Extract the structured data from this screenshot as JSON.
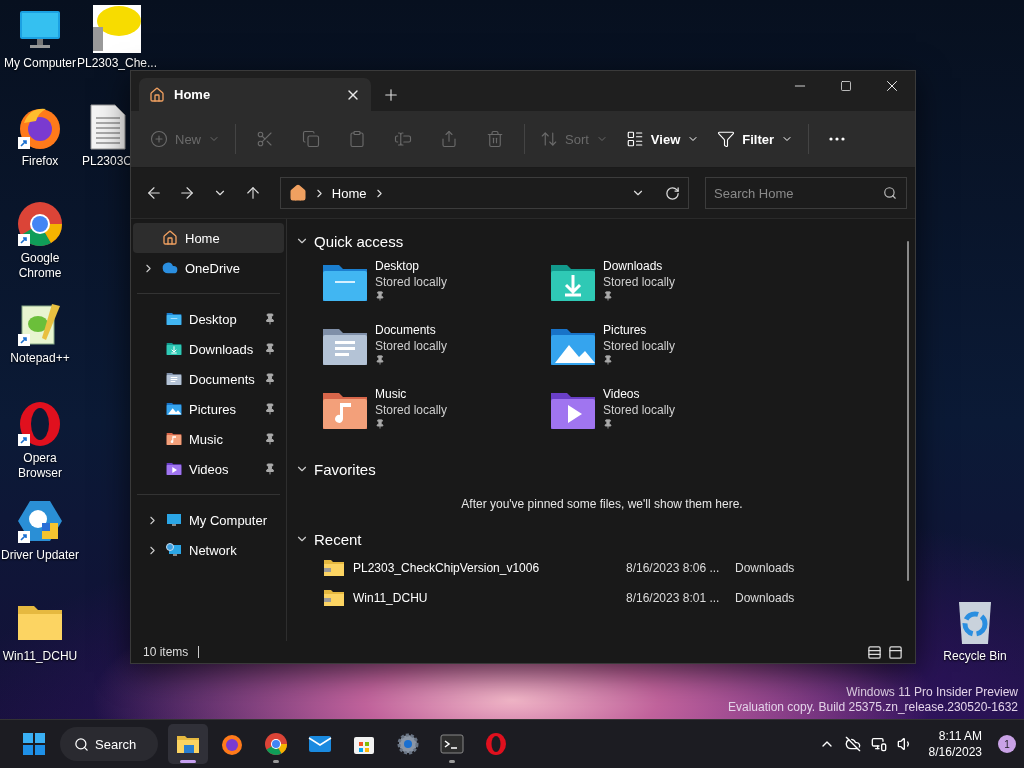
{
  "desktop_icons": [
    {
      "label": "My Computer",
      "kind": "computer",
      "shortcut": false
    },
    {
      "label": "PL2303_Che...",
      "kind": "image",
      "shortcut": false
    },
    {
      "label": "Firefox",
      "kind": "firefox",
      "shortcut": true
    },
    {
      "label": "PL2303C",
      "kind": "document",
      "shortcut": false
    },
    {
      "label": "Google Chrome",
      "kind": "chrome",
      "shortcut": true
    },
    {
      "label": "Notepad++",
      "kind": "notepad",
      "shortcut": true
    },
    {
      "label": "Opera Browser",
      "kind": "opera",
      "shortcut": true
    },
    {
      "label": "Driver Updater",
      "kind": "driver",
      "shortcut": true
    },
    {
      "label": "Win11_DCHU",
      "kind": "folder",
      "shortcut": false
    },
    {
      "label": "Recycle Bin",
      "kind": "recycle",
      "shortcut": false
    }
  ],
  "explorer": {
    "tabs": [
      {
        "label": "Home",
        "selected": true
      }
    ],
    "toolbar": [
      [
        {
          "kind": "new",
          "label": "New",
          "disabled": true,
          "menu": true
        }
      ],
      [
        {
          "kind": "cut",
          "disabled": true
        },
        {
          "kind": "copy",
          "disabled": true
        },
        {
          "kind": "paste",
          "disabled": true
        },
        {
          "kind": "rename",
          "disabled": true
        },
        {
          "kind": "share",
          "disabled": true
        },
        {
          "kind": "delete",
          "disabled": true
        }
      ],
      [
        {
          "kind": "sort",
          "label": "Sort",
          "disabled": true,
          "menu": true
        },
        {
          "kind": "view",
          "label": "View",
          "disabled": false,
          "menu": true
        },
        {
          "kind": "filter",
          "label": "Filter",
          "disabled": false,
          "menu": true
        }
      ],
      [
        {
          "kind": "more",
          "disabled": false
        }
      ]
    ],
    "address": {
      "crumbs": [
        "Home"
      ]
    },
    "search": {
      "placeholder": "Search Home"
    },
    "sidebar": [
      [
        {
          "label": "Home",
          "kind": "plain",
          "selected": true
        },
        {
          "label": "OneDrive",
          "kind": "expandable",
          "selected": false
        }
      ],
      [
        {
          "label": "Desktop",
          "kind": "pinned",
          "selected": false
        },
        {
          "label": "Downloads",
          "kind": "pinned",
          "selected": false
        },
        {
          "label": "Documents",
          "kind": "pinned",
          "selected": false
        },
        {
          "label": "Pictures",
          "kind": "pinned",
          "selected": false
        },
        {
          "label": "Music",
          "kind": "pinned",
          "selected": false
        },
        {
          "label": "Videos",
          "kind": "pinned",
          "selected": false
        }
      ],
      [
        {
          "label": "My Computer",
          "kind": "expandable",
          "selected": false
        },
        {
          "label": "Network",
          "kind": "expandable",
          "selected": false
        }
      ]
    ],
    "quick_access": {
      "title": "Quick access",
      "items": [
        {
          "name": "Desktop",
          "status": "Stored locally",
          "kind": "desktop",
          "pinned": true
        },
        {
          "name": "Downloads",
          "status": "Stored locally",
          "kind": "downloads",
          "pinned": true
        },
        {
          "name": "Documents",
          "status": "Stored locally",
          "kind": "documents",
          "pinned": true
        },
        {
          "name": "Pictures",
          "status": "Stored locally",
          "kind": "pictures",
          "pinned": true
        },
        {
          "name": "Music",
          "status": "Stored locally",
          "kind": "music",
          "pinned": true
        },
        {
          "name": "Videos",
          "status": "Stored locally",
          "kind": "videos",
          "pinned": true
        }
      ]
    },
    "favorites": {
      "title": "Favorites",
      "message": "After you've pinned some files, we'll show them here."
    },
    "recent": {
      "title": "Recent",
      "rows": [
        {
          "name": "PL2303_CheckChipVersion_v1006",
          "date": "8/16/2023 8:06 ...",
          "location": "Downloads"
        },
        {
          "name": "Win11_DCHU",
          "date": "8/16/2023 8:01 ...",
          "location": "Downloads"
        }
      ]
    },
    "status_bar": {
      "count": "10 items"
    }
  },
  "evaluation_notice": [
    "Windows 11 Pro Insider Preview",
    "Evaluation copy. Build 25375.zn_release.230520-1632"
  ],
  "taskbar": {
    "search_label": "Search",
    "apps": [
      {
        "kind": "explorer",
        "active": true,
        "running": true
      },
      {
        "kind": "firefox",
        "active": false,
        "running": false
      },
      {
        "kind": "chrome",
        "active": false,
        "running": true
      },
      {
        "kind": "mail",
        "active": false,
        "running": false
      },
      {
        "kind": "store",
        "active": false,
        "running": false
      },
      {
        "kind": "settings",
        "active": false,
        "running": false
      },
      {
        "kind": "terminal",
        "active": false,
        "running": true
      },
      {
        "kind": "opera",
        "active": false,
        "running": false
      }
    ],
    "time": "8:11 AM",
    "date": "8/16/2023",
    "notifications": "1"
  }
}
